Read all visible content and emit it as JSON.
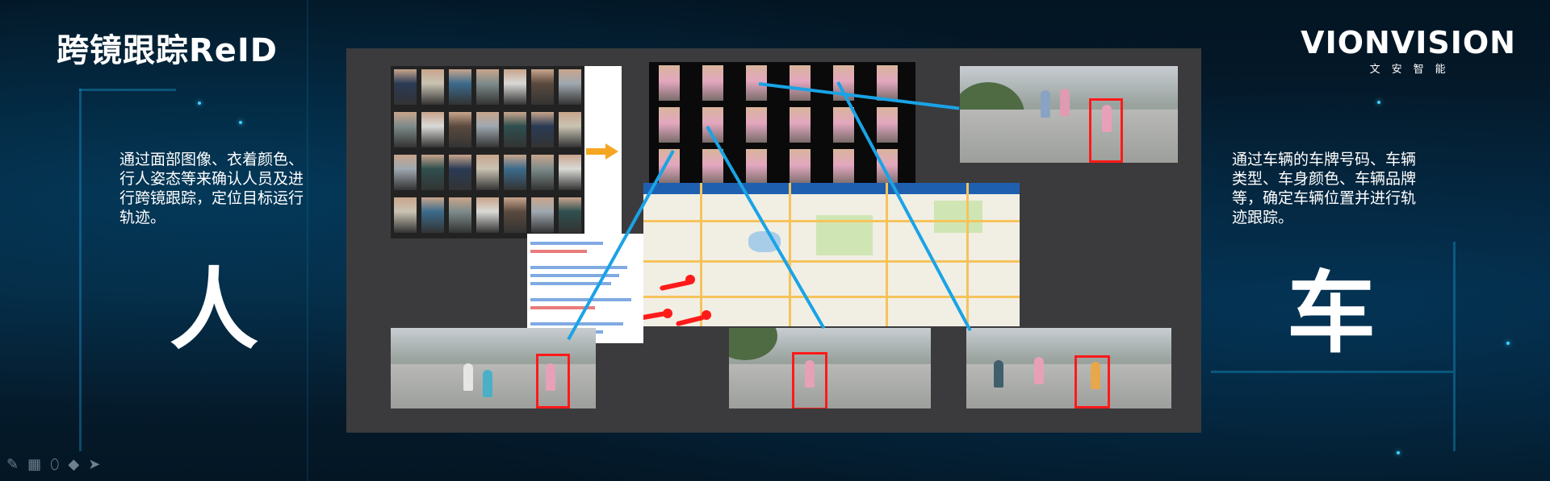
{
  "slide": {
    "title": "跨镜跟踪ReID",
    "logo_main": "VIONVISION",
    "logo_sub": "文安智能",
    "person_label": "人",
    "vehicle_label": "车",
    "person_description": "通过面部图像、衣着颜色、行人姿态等来确认人员及进行跨镜跟踪，定位目标运行轨迹。",
    "vehicle_description": "通过车辆的车牌号码、车辆类型、车身颜色、车辆品牌等，确定车辆位置并进行轨迹跟踪。"
  },
  "colors": {
    "accent_line": "#1aa3e6",
    "highlight_box": "#ff1a1a",
    "panel": "#3b3b3d",
    "arrow": "#f5a623"
  },
  "icons": [
    "pen-icon",
    "keyboard-icon",
    "eraser-icon",
    "highlighter-icon",
    "pointer-icon"
  ]
}
